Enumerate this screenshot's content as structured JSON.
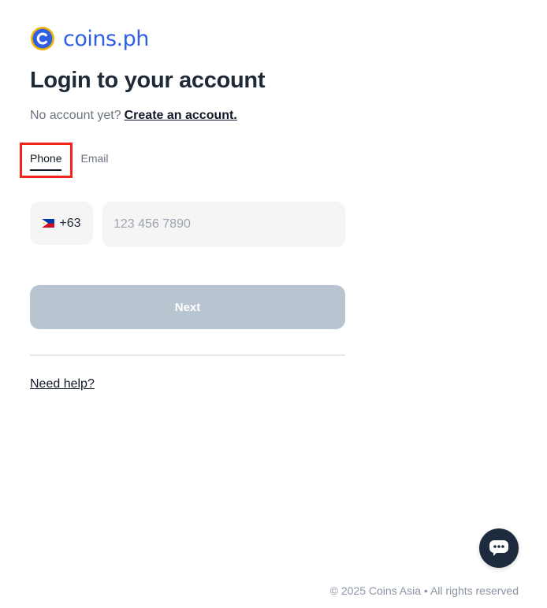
{
  "brand": {
    "name": "coins.ph",
    "logo_icon": "coins-c-logo-icon",
    "accent_color": "#2f5fe3",
    "logo_ring_color": "#f4b400"
  },
  "login": {
    "title": "Login to your account",
    "no_account_text": "No account yet?",
    "create_account_link": "Create an account."
  },
  "tabs": [
    {
      "label": "Phone",
      "active": true
    },
    {
      "label": "Email",
      "active": false
    }
  ],
  "phone": {
    "country_flag_icon": "philippines-flag-icon",
    "country_code": "+63",
    "value": "",
    "placeholder": "123 456 7890"
  },
  "actions": {
    "next_label": "Next",
    "next_button_color": "#b8c4cf",
    "help_link": "Need help?"
  },
  "chat": {
    "icon": "chat-bubble-icon",
    "background": "#1e2a3d"
  },
  "footer": {
    "copyright": "© 2025 Coins Asia • All rights reserved"
  },
  "highlight": {
    "color": "#f2251c",
    "target": "Phone tab"
  }
}
